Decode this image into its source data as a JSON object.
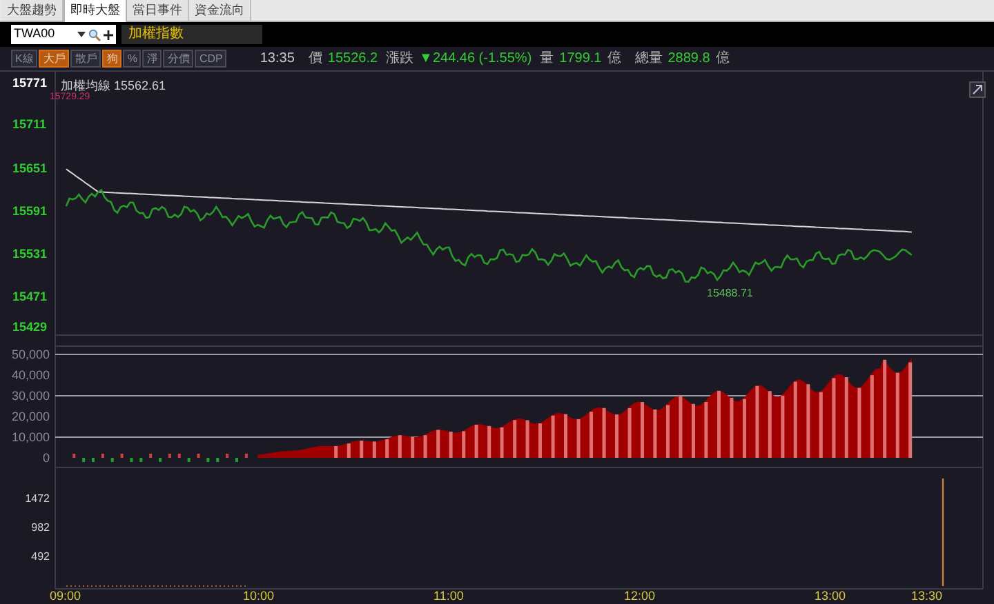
{
  "tabs": [
    {
      "label": "大盤趨勢",
      "selected": false
    },
    {
      "label": "即時大盤",
      "selected": true
    },
    {
      "label": "當日事件",
      "selected": false
    },
    {
      "label": "資金流向",
      "selected": false
    }
  ],
  "symbol_field": {
    "value": "TWA00"
  },
  "index_name": "加權指數",
  "toolbar": [
    {
      "label": "K線",
      "selected": false
    },
    {
      "label": "大戶",
      "selected": true
    },
    {
      "label": "散戶",
      "selected": false
    },
    {
      "label": "狗",
      "selected": true
    },
    {
      "label": "%",
      "selected": false
    },
    {
      "label": "淨",
      "selected": false
    },
    {
      "label": "分價",
      "selected": false
    },
    {
      "label": "CDP",
      "selected": false
    }
  ],
  "quote": {
    "time": "13:35",
    "price_label": "價",
    "price": "15526.2",
    "change_label": "漲跌",
    "change": "▼244.46 (-1.55%)",
    "volume_label": "量",
    "volume": "1799.1",
    "volume_unit": "億",
    "total_label": "總量",
    "total": "2889.8",
    "total_unit": "億"
  },
  "price_panel": {
    "legend": "加權均線 15562.61",
    "high_marker": "15729.29",
    "low_marker": "15488.71",
    "y_labels": [
      "15771",
      "15711",
      "15651",
      "15591",
      "15531",
      "15471",
      "15429"
    ]
  },
  "volume_panel": {
    "y_labels": [
      "50,000",
      "40,000",
      "30,000",
      "20,000",
      "10,000",
      "0"
    ]
  },
  "bottom_panel": {
    "y_labels": [
      "1472",
      "982",
      "492"
    ]
  },
  "x_labels": [
    "09:00",
    "10:00",
    "11:00",
    "12:00",
    "13:00",
    "13:30"
  ]
}
